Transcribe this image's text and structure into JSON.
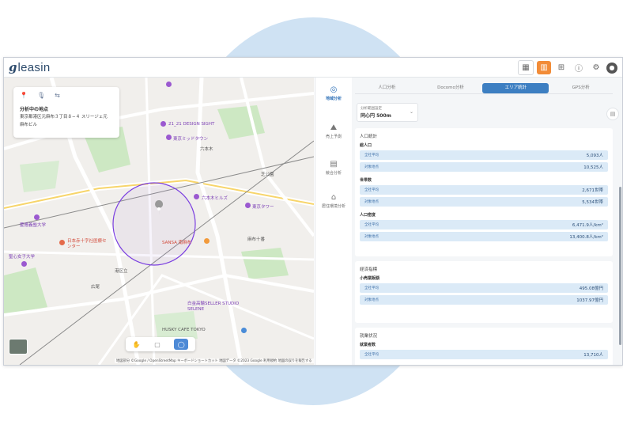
{
  "app": {
    "logo_mark": "g",
    "logo_text": "leasin"
  },
  "topbar": {
    "icons": [
      "map-icon",
      "chart-icon",
      "grid-icon",
      "info-icon",
      "gear-icon",
      "user-icon"
    ]
  },
  "map": {
    "card": {
      "tools": [
        "📍",
        "🎙",
        "⇆"
      ],
      "title": "分析中の地点",
      "address_line1": "東京都港区元麻布３丁目８−４ スリージェ元",
      "address_line2": "麻布ビル"
    },
    "labels": {
      "design_sight": "21_21 DESIGN SIGHT",
      "midtown": "東京ミッドタウン",
      "roppongi": "六本木ヒルズ",
      "roppongi_st": "六本木",
      "tokyo_tower": "東京タワー",
      "hospital": "日本赤十字社医療センター",
      "sansa": "SANSA 南麻布",
      "hiroo": "広尾",
      "sacred": "聖心女子大学",
      "university": "慶應義塾大学",
      "azabu": "麻布十番",
      "husky": "HUSKY CAFE TOKYO",
      "studio": "白金高輪SELLER STUDIO SELENE",
      "tamachi": "港区立",
      "shiba": "芝公園"
    },
    "attribution": "地図部分 ©Google / OpenStreetMap  キーボードショートカット  地図データ ©2023 Google  利用規約  地図の誤りを報告する"
  },
  "sidenav": {
    "items": [
      {
        "icon": "◎",
        "label": "地域分析",
        "active": true
      },
      {
        "icon": "⛰",
        "label": "売上予測",
        "active": false
      },
      {
        "icon": "▤",
        "label": "競合分析",
        "active": false
      },
      {
        "icon": "⌂",
        "label": "居住環境分析",
        "active": false
      }
    ]
  },
  "panel": {
    "tabs": [
      "人口分析",
      "Docomo分析",
      "エリア統計",
      "GPS分析"
    ],
    "active_tab": 2,
    "range": {
      "label": "分析範囲設定",
      "value": "同心円 500m"
    },
    "sections": [
      {
        "title": "人口統計",
        "groups": [
          {
            "name": "総人口",
            "rows": [
              {
                "label": "全社平均",
                "value": "5,093人"
              },
              {
                "label": "対象地点",
                "value": "10,525人"
              }
            ]
          },
          {
            "name": "世帯数",
            "rows": [
              {
                "label": "全社平均",
                "value": "2,671世帯"
              },
              {
                "label": "対象地点",
                "value": "5,534世帯"
              }
            ]
          },
          {
            "name": "人口密度",
            "rows": [
              {
                "label": "全社平均",
                "value": "6,471.9人/km²"
              },
              {
                "label": "対象地点",
                "value": "13,400.8人/km²"
              }
            ]
          }
        ]
      },
      {
        "title": "経済指標",
        "groups": [
          {
            "name": "小売業販額",
            "rows": [
              {
                "label": "全社平均",
                "value": "495.08億円"
              },
              {
                "label": "対象地点",
                "value": "1037.97億円"
              }
            ]
          }
        ]
      },
      {
        "title": "就業状況",
        "groups": [
          {
            "name": "就業者数",
            "rows": [
              {
                "label": "全社平均",
                "value": "13,710人"
              }
            ]
          }
        ]
      }
    ]
  },
  "colors": {
    "accent": "#3d7fc2",
    "brand": "#2c4a6b",
    "active_icon": "#f28c38",
    "row_bg": "#dbeaf7"
  }
}
